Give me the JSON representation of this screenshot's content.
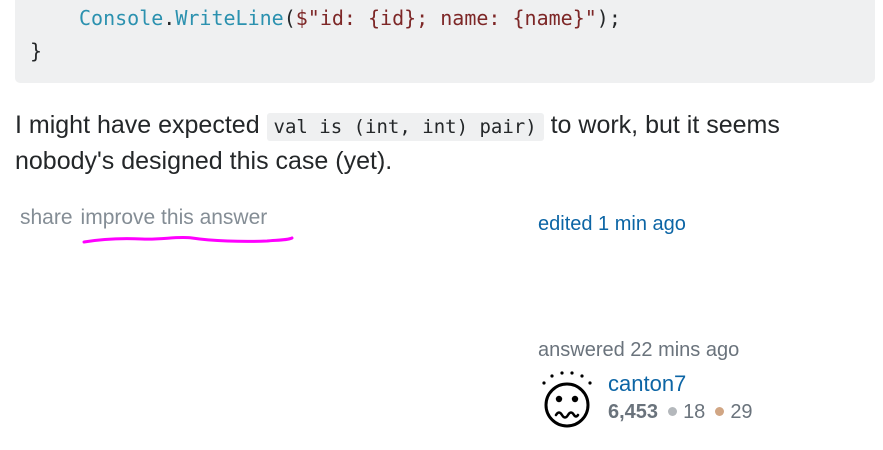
{
  "code": {
    "line1": {
      "method_owner": "Console",
      "dot": ".",
      "method": "WriteLine",
      "open": "(",
      "string": "$\"id: {id}; name: {name}\"",
      "close": ");"
    },
    "line2": "}"
  },
  "answer": {
    "text_before": "I might have expected ",
    "inline_code": "val is (int, int) pair)",
    "text_after": " to work, but it seems nobody's designed this case (yet)."
  },
  "post_menu": {
    "share_label": "share",
    "improve_label": "improve this answer"
  },
  "edited": {
    "text": "edited 1 min ago"
  },
  "user_card": {
    "answered_text": "answered 22 mins ago",
    "user_name": "canton7",
    "reputation": "6,453",
    "silver_badges": "18",
    "bronze_badges": "29",
    "silver_color": "#b4b8bc",
    "bronze_color": "#d1a684",
    "avatar_icon": "worried-face-icon"
  },
  "annotation": {
    "underline_color": "#ff00ff"
  }
}
